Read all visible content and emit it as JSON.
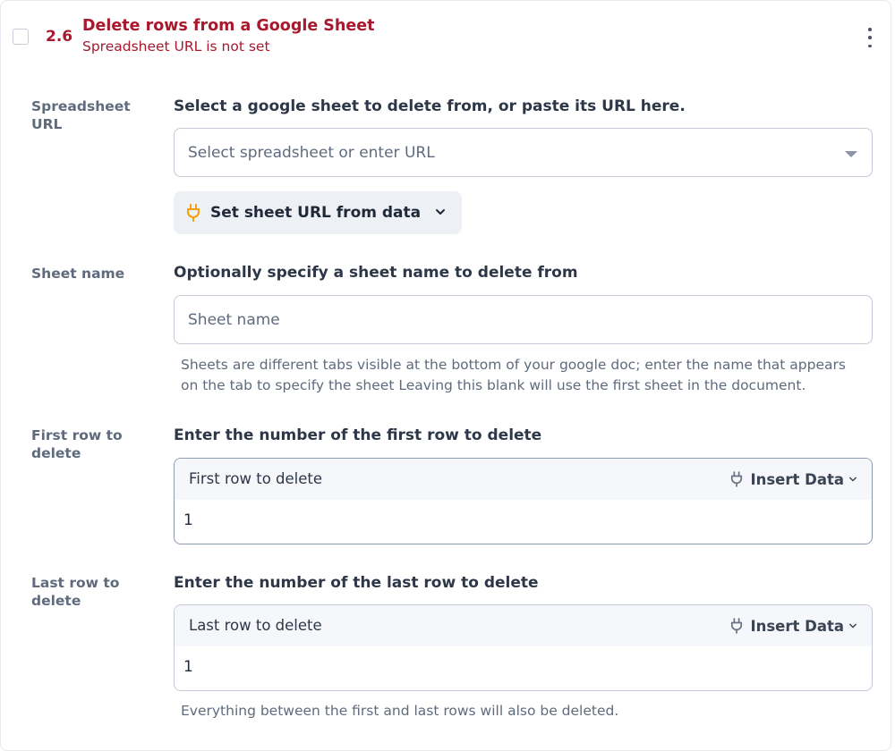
{
  "step": {
    "number": "2.6",
    "title": "Delete rows from a Google Sheet",
    "subtitle": "Spreadsheet URL is not set"
  },
  "fields": {
    "spreadsheet_url": {
      "label": "Spreadsheet URL",
      "description": "Select a google sheet to delete from, or paste its URL here.",
      "placeholder": "Select spreadsheet or enter URL",
      "data_button": "Set sheet URL from data"
    },
    "sheet_name": {
      "label": "Sheet name",
      "description": "Optionally specify a sheet name to delete from",
      "placeholder": "Sheet name",
      "help_line1": "Sheets are different tabs visible at the bottom of your google doc; enter the name that appears",
      "help_line2": "on the tab to specify the sheet Leaving this blank will use the first sheet in the document."
    },
    "first_row": {
      "label": "First row to delete",
      "description": "Enter the number of the first row to delete",
      "field_label": "First row to delete",
      "insert_label": "Insert Data",
      "value": "1"
    },
    "last_row": {
      "label": "Last row to delete",
      "description": "Enter the number of the last row to delete",
      "field_label": "Last row to delete",
      "insert_label": "Insert Data",
      "value": "1",
      "help": "Everything between the first and last rows will also be deleted."
    }
  },
  "colors": {
    "accent_red": "#a8192e",
    "plug_orange": "#f59e0b"
  }
}
